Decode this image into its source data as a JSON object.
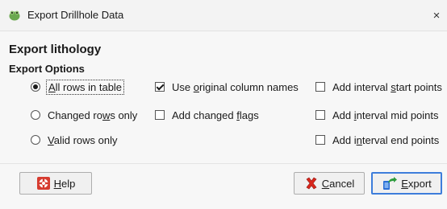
{
  "window": {
    "title": "Export Drillhole Data",
    "close_glyph": "×",
    "app_icon": "leapfrog-icon"
  },
  "dialog": {
    "heading": "Export lithology",
    "section_label": "Export Options"
  },
  "rows_options": [
    {
      "pre": "",
      "key": "A",
      "post": "ll rows in table",
      "selected": true
    },
    {
      "pre": "Changed ro",
      "key": "w",
      "post": "s only",
      "selected": false
    },
    {
      "pre": "",
      "key": "V",
      "post": "alid rows only",
      "selected": false
    }
  ],
  "middle_checks": [
    {
      "pre": "Use ",
      "key": "o",
      "post": "riginal column names",
      "checked": true
    },
    {
      "pre": "Add changed ",
      "key": "f",
      "post": "lags",
      "checked": false
    }
  ],
  "interval_checks": [
    {
      "pre": "Add interval ",
      "key": "s",
      "post": "tart points",
      "checked": false
    },
    {
      "pre": "Add ",
      "key": "i",
      "post": "nterval mid points",
      "checked": false
    },
    {
      "pre": "Add i",
      "key": "n",
      "post": "terval end points",
      "checked": false
    }
  ],
  "buttons": {
    "help": {
      "key": "H",
      "post": "elp",
      "icon": "lifebuoy-icon"
    },
    "cancel": {
      "key": "C",
      "post": "ancel",
      "icon": "cancel-x-icon"
    },
    "export": {
      "key": "E",
      "post": "xport",
      "icon": "export-arrow-icon"
    }
  },
  "colors": {
    "default_button_border": "#3d7ddb",
    "help_icon": "#d63b2f",
    "cancel_icon": "#d9261c",
    "export_icon": "#2a6fd6",
    "app_icon": "#6aa84f"
  }
}
